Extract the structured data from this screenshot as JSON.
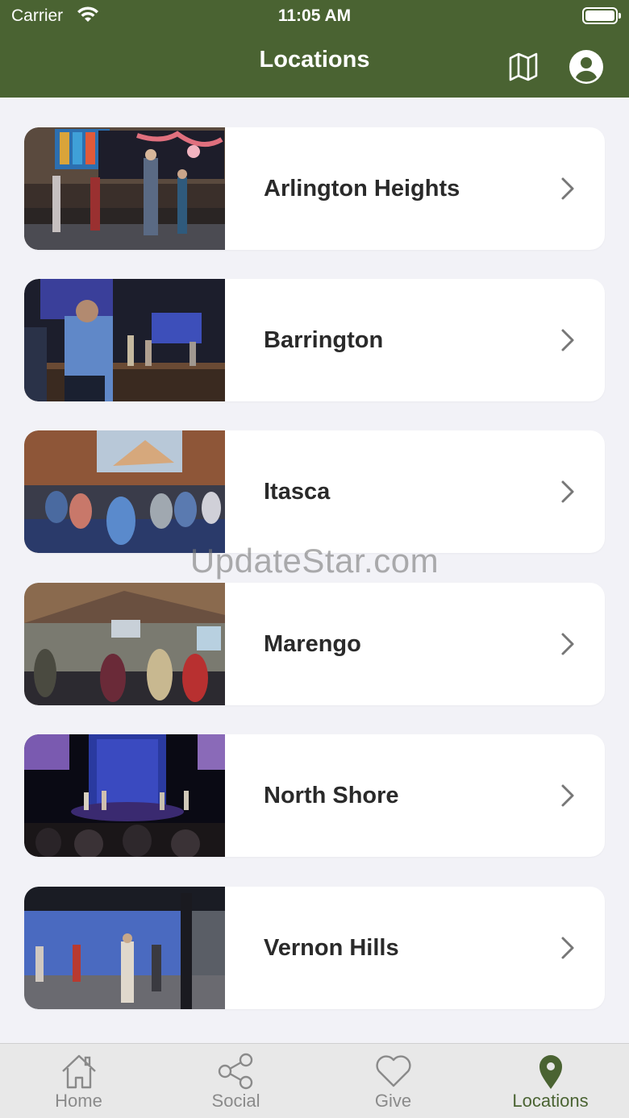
{
  "status_bar": {
    "carrier": "Carrier",
    "time": "11:05 AM"
  },
  "nav": {
    "title": "Locations",
    "map_icon": "map-icon",
    "profile_icon": "person-icon"
  },
  "colors": {
    "header_bg": "#4a6332",
    "accent": "#4a6332",
    "tab_inactive": "#8a8a8a",
    "page_bg": "#f2f2f7"
  },
  "locations": [
    {
      "name": "Arlington Heights"
    },
    {
      "name": "Barrington"
    },
    {
      "name": "Itasca"
    },
    {
      "name": "Marengo"
    },
    {
      "name": "North Shore"
    },
    {
      "name": "Vernon Hills"
    }
  ],
  "watermark": "UpdateStar.com",
  "tabs": [
    {
      "label": "Home",
      "icon": "home-icon",
      "active": false
    },
    {
      "label": "Social",
      "icon": "share-icon",
      "active": false
    },
    {
      "label": "Give",
      "icon": "heart-icon",
      "active": false
    },
    {
      "label": "Locations",
      "icon": "location-pin-icon",
      "active": true
    }
  ]
}
